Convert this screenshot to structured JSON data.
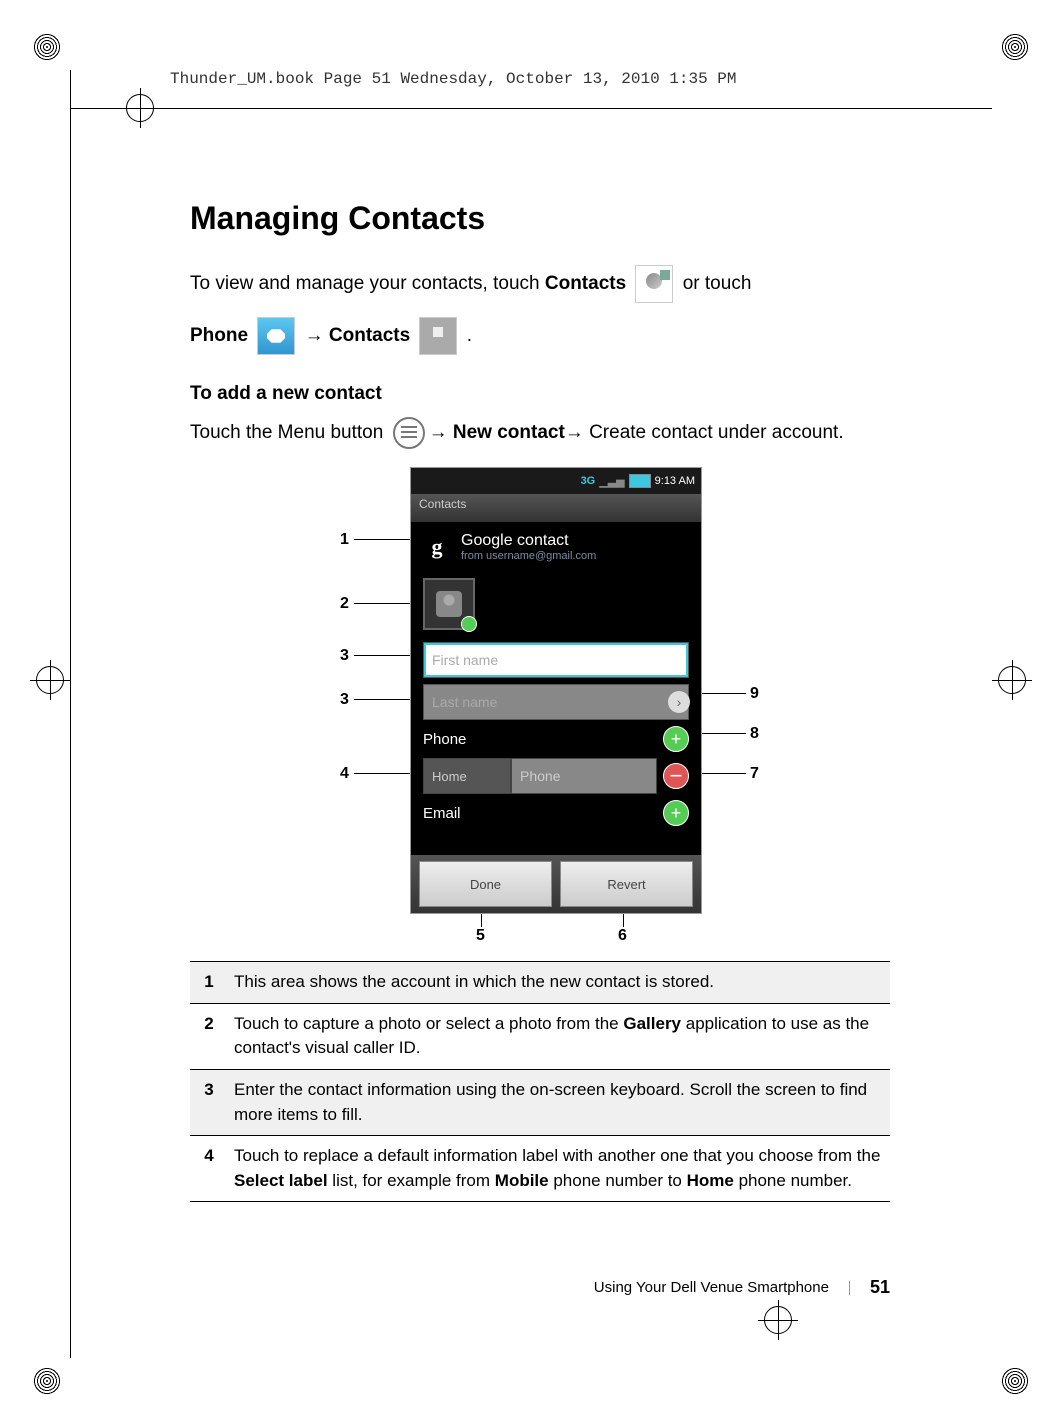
{
  "print": {
    "header": "Thunder_UM.book  Page 51  Wednesday, October 13, 2010  1:35 PM"
  },
  "title": "Managing Contacts",
  "intro_p1a": "To view and manage your contacts, touch ",
  "intro_p1b": "Contacts",
  "intro_p1c": " or touch ",
  "intro_p2a": "Phone",
  "intro_p2b": "Contacts",
  "intro_p2c": ".",
  "arrow": "→",
  "subhead": "To add a new contact",
  "addline_a": "Touch the Menu button ",
  "addline_b": "New contact",
  "addline_c": " Create contact under account.",
  "screenshot": {
    "status_time": "9:13 AM",
    "status_3g": "3G",
    "tab": "Contacts",
    "google_icon": "g",
    "acct_l1": "Google contact",
    "acct_l2": "from username@gmail.com",
    "first_name": "First name",
    "last_name": "Last name",
    "phone_section": "Phone",
    "home_label": "Home",
    "phone_value": "Phone",
    "email_section": "Email",
    "done": "Done",
    "revert": "Revert"
  },
  "callouts": {
    "c1": "1",
    "c2": "2",
    "c3": "3",
    "c3b": "3",
    "c4": "4",
    "c5": "5",
    "c6": "6",
    "c7": "7",
    "c8": "8",
    "c9": "9"
  },
  "legend": [
    {
      "n": "1",
      "t1": "This area shows the account in which the new contact is stored."
    },
    {
      "n": "2",
      "t1": "Touch to capture a photo or select a photo from the ",
      "b1": "Gallery",
      "t2": " application to use as the contact's visual caller ID."
    },
    {
      "n": "3",
      "t1": "Enter the contact information using the on-screen keyboard. Scroll the screen to find more items to fill."
    },
    {
      "n": "4",
      "t1": "Touch to replace a default information label with another one that you choose from the ",
      "b1": "Select label",
      "t2": " list, for example from ",
      "b2": "Mobile",
      "t3": " phone number to ",
      "b3": "Home",
      "t4": " phone number."
    }
  ],
  "footer": {
    "section": "Using Your Dell Venue Smartphone",
    "page": "51"
  }
}
